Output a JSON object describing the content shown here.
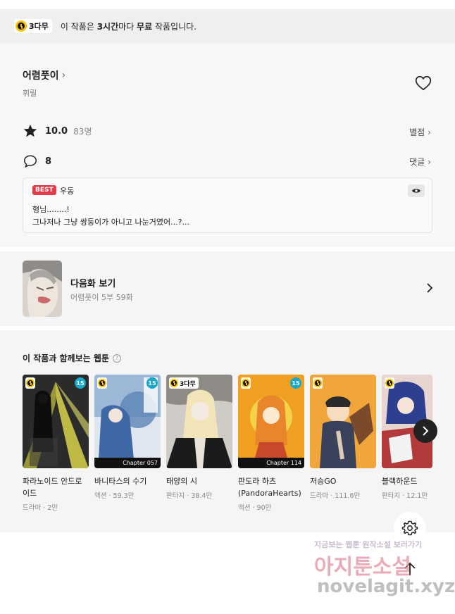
{
  "notice": {
    "badge": "3다무",
    "text_prefix": "이 작품은 ",
    "text_bold1": "3시간",
    "text_mid": "마다 ",
    "text_bold2": "무료",
    "text_suffix": " 작품입니다."
  },
  "work": {
    "author": "어렴풋이",
    "sub": "휘릴",
    "rating": "10.0",
    "rating_count": "83명",
    "rating_link": "별점",
    "comment_count": "8",
    "comment_link": "댓글"
  },
  "best_comment": {
    "tag": "BEST",
    "user": "우동",
    "line1": "형님........!",
    "line2": "그나저나 그냥 쌍둥이가 아니고 나눈거였어...?..."
  },
  "next_episode": {
    "title": "다음화 보기",
    "sub": "어렴풋이 5부 59화"
  },
  "recommend": {
    "title": "이 작품과 함께보는 웹툰",
    "help": "?",
    "cards": [
      {
        "title": "파라노이드 안드로이드",
        "genre": "드라마",
        "count": "2만",
        "age": "15",
        "badge": "",
        "chapter": ""
      },
      {
        "title": "바니타스의 수기",
        "genre": "액션",
        "count": "59.3만",
        "age": "15",
        "badge": "",
        "chapter": "Chapter 057"
      },
      {
        "title": "태양의 시",
        "genre": "판타지",
        "count": "38.4만",
        "age": "",
        "badge": "3다무",
        "chapter": ""
      },
      {
        "title": "판도라 하츠(PandoraHearts)",
        "genre": "액션",
        "count": "90만",
        "age": "15",
        "badge": "",
        "chapter": "Chapter 114"
      },
      {
        "title": "저승GO",
        "genre": "드라마",
        "count": "111.6만",
        "age": "",
        "badge": "",
        "chapter": ""
      },
      {
        "title": "블랙하운드",
        "genre": "판타지",
        "count": "12.1만",
        "age": "",
        "badge": "",
        "chapter": ""
      }
    ]
  },
  "watermark": {
    "line1": "지금보는 웹툰 원작소설 보러가기",
    "line2": "아지툰소설",
    "line3": "novelagit.xyz"
  },
  "colors": {
    "accent_yellow": "#f7c600",
    "best_red": "#e53a4a",
    "age_badge": "#17a9c9"
  }
}
